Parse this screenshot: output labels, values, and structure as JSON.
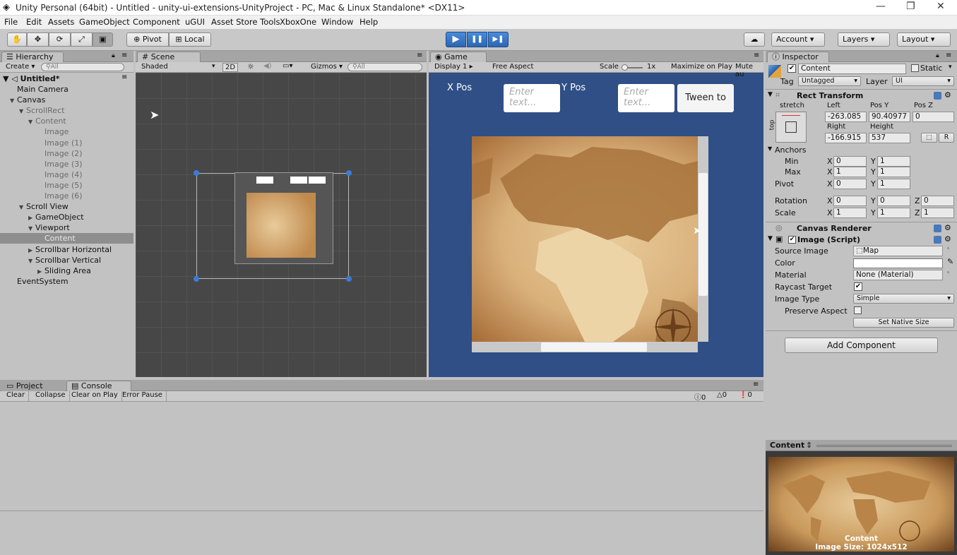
{
  "window": {
    "title": "Unity Personal (64bit) - Untitled - unity-ui-extensions-UnityProject - PC, Mac & Linux Standalone* <DX11>",
    "minimize": "—",
    "maximize": "❐",
    "close": "✕"
  },
  "menu": [
    "File",
    "Edit",
    "Assets",
    "GameObject",
    "Component",
    "uGUI",
    "Asset Store Tools",
    "XboxOne",
    "Window",
    "Help"
  ],
  "toolbar": {
    "pivot": "Pivot",
    "local": "Local",
    "play": "▶",
    "pause": "❚❚",
    "step": "▶❚",
    "account": "Account",
    "layers": "Layers",
    "layout": "Layout"
  },
  "hierarchy": {
    "tab": "Hierarchy",
    "create": "Create",
    "search_placeholder": "All",
    "scene": "Untitled*",
    "items": [
      {
        "label": "Main Camera",
        "indent": 0,
        "arrow": "",
        "grey": false
      },
      {
        "label": "Canvas",
        "indent": 0,
        "arrow": "▼",
        "grey": false
      },
      {
        "label": "ScrollRect",
        "indent": 1,
        "arrow": "▼",
        "grey": true
      },
      {
        "label": "Content",
        "indent": 2,
        "arrow": "▼",
        "grey": true
      },
      {
        "label": "Image",
        "indent": 3,
        "arrow": "",
        "grey": true
      },
      {
        "label": "Image (1)",
        "indent": 3,
        "arrow": "",
        "grey": true
      },
      {
        "label": "Image (2)",
        "indent": 3,
        "arrow": "",
        "grey": true
      },
      {
        "label": "Image (3)",
        "indent": 3,
        "arrow": "",
        "grey": true
      },
      {
        "label": "Image (4)",
        "indent": 3,
        "arrow": "",
        "grey": true
      },
      {
        "label": "Image (5)",
        "indent": 3,
        "arrow": "",
        "grey": true
      },
      {
        "label": "Image (6)",
        "indent": 3,
        "arrow": "",
        "grey": true
      },
      {
        "label": "Scroll View",
        "indent": 1,
        "arrow": "▼",
        "grey": false
      },
      {
        "label": "GameObject",
        "indent": 2,
        "arrow": "▶",
        "grey": false
      },
      {
        "label": "Viewport",
        "indent": 2,
        "arrow": "▼",
        "grey": false
      },
      {
        "label": "Content",
        "indent": 3,
        "arrow": "",
        "grey": false,
        "selected": true
      },
      {
        "label": "Scrollbar Horizontal",
        "indent": 2,
        "arrow": "▶",
        "grey": false
      },
      {
        "label": "Scrollbar Vertical",
        "indent": 2,
        "arrow": "▼",
        "grey": false
      },
      {
        "label": "Sliding Area",
        "indent": 3,
        "arrow": "▶",
        "grey": false
      },
      {
        "label": "EventSystem",
        "indent": 0,
        "arrow": "",
        "grey": false
      }
    ]
  },
  "scene": {
    "tab": "Scene",
    "shading": "Shaded",
    "mode2d": "2D",
    "gizmos": "Gizmos",
    "search_placeholder": "All"
  },
  "game": {
    "tab": "Game",
    "display": "Display 1",
    "aspect": "Free Aspect",
    "scale_label": "Scale",
    "scale_value": "1x",
    "maximize": "Maximize on Play",
    "mute": "Mute au",
    "xpos_label": "X Pos",
    "ypos_label": "Y Pos",
    "input_placeholder": "Enter text...",
    "tween_button": "Tween to"
  },
  "inspector": {
    "tab": "Inspector",
    "object_name": "Content",
    "static_label": "Static",
    "tag_label": "Tag",
    "tag_value": "Untagged",
    "layer_label": "Layer",
    "layer_value": "UI",
    "rect_transform": "Rect Transform",
    "stretch": "stretch",
    "top": "top",
    "left_label": "Left",
    "left_value": "-263.085",
    "posy_label": "Pos Y",
    "posy_value": "90.40977",
    "posz_label": "Pos Z",
    "posz_value": "0",
    "right_label": "Right",
    "right_value": "-166.915",
    "height_label": "Height",
    "height_value": "537",
    "r_btn": "R",
    "anchors": "Anchors",
    "min_label": "Min",
    "max_label": "Max",
    "anchor_min_x": "0",
    "anchor_min_y": "1",
    "anchor_max_x": "1",
    "anchor_max_y": "1",
    "pivot_label": "Pivot",
    "pivot_x": "0",
    "pivot_y": "1",
    "rotation_label": "Rotation",
    "rot_x": "0",
    "rot_y": "0",
    "rot_z": "0",
    "scale_label": "Scale",
    "scale_x": "1",
    "scale_y": "1",
    "scale_z": "1",
    "x": "X",
    "y": "Y",
    "z": "Z",
    "canvas_renderer": "Canvas Renderer",
    "image_script": "Image (Script)",
    "source_image_label": "Source Image",
    "source_image_value": "Map",
    "color_label": "Color",
    "material_label": "Material",
    "material_value": "None (Material)",
    "raycast_label": "Raycast Target",
    "image_type_label": "Image Type",
    "image_type_value": "Simple",
    "preserve_label": "Preserve Aspect",
    "native_size": "Set Native Size",
    "add_component": "Add Component",
    "preview_title": "Content",
    "preview_name": "Content",
    "preview_size": "Image Size: 1024x512"
  },
  "console": {
    "project_tab": "Project",
    "console_tab": "Console",
    "clear": "Clear",
    "collapse": "Collapse",
    "clear_on_play": "Clear on Play",
    "error_pause": "Error Pause",
    "info_count": "0",
    "warn_count": "0",
    "error_count": "0"
  },
  "colors": {
    "game_bg": "#2f4f86",
    "scene_bg": "#474747",
    "accent": "#3d7bd6",
    "map_light": "#e8cb9a",
    "map_dark": "#a56a35"
  }
}
